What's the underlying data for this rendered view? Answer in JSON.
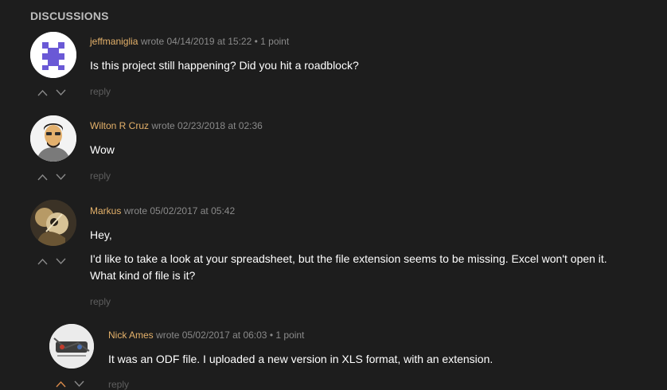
{
  "heading": "DISCUSSIONS",
  "colors": {
    "background": "#1d1d1d",
    "author": "#e4b16a",
    "meta": "#8a8a8a",
    "reply": "#5f5f5f",
    "reply_vote_accent": "#d98a4a"
  },
  "comments": [
    {
      "author": "jeffmaniglia",
      "wrote": "wrote 04/14/2019 at 15:22",
      "points": "• 1 point",
      "body": [
        "Is this project still happening? Did you hit a roadblock?"
      ],
      "reply": "reply",
      "avatar": "identicon-avatar"
    },
    {
      "author": "Wilton R Cruz",
      "wrote": "wrote 02/23/2018 at 02:36",
      "points": "",
      "body": [
        "Wow"
      ],
      "reply": "reply",
      "avatar": "cartoon-portrait-avatar"
    },
    {
      "author": "Markus",
      "wrote": "wrote 05/02/2017 at 05:42",
      "points": "",
      "body": [
        "Hey,",
        "I'd like to take a look at your spreadsheet, but the file extension seems to be missing. Excel won't open it. What kind of file is it?"
      ],
      "reply": "reply",
      "avatar": "sepia-photo-avatar"
    },
    {
      "author": "Nick Ames",
      "wrote": "wrote 05/02/2017 at 06:03",
      "points": "• 1 point",
      "body": [
        "It was an ODF file. I uploaded a new version in XLS format, with an extension."
      ],
      "reply": "reply",
      "avatar": "circuit-photo-avatar"
    }
  ]
}
